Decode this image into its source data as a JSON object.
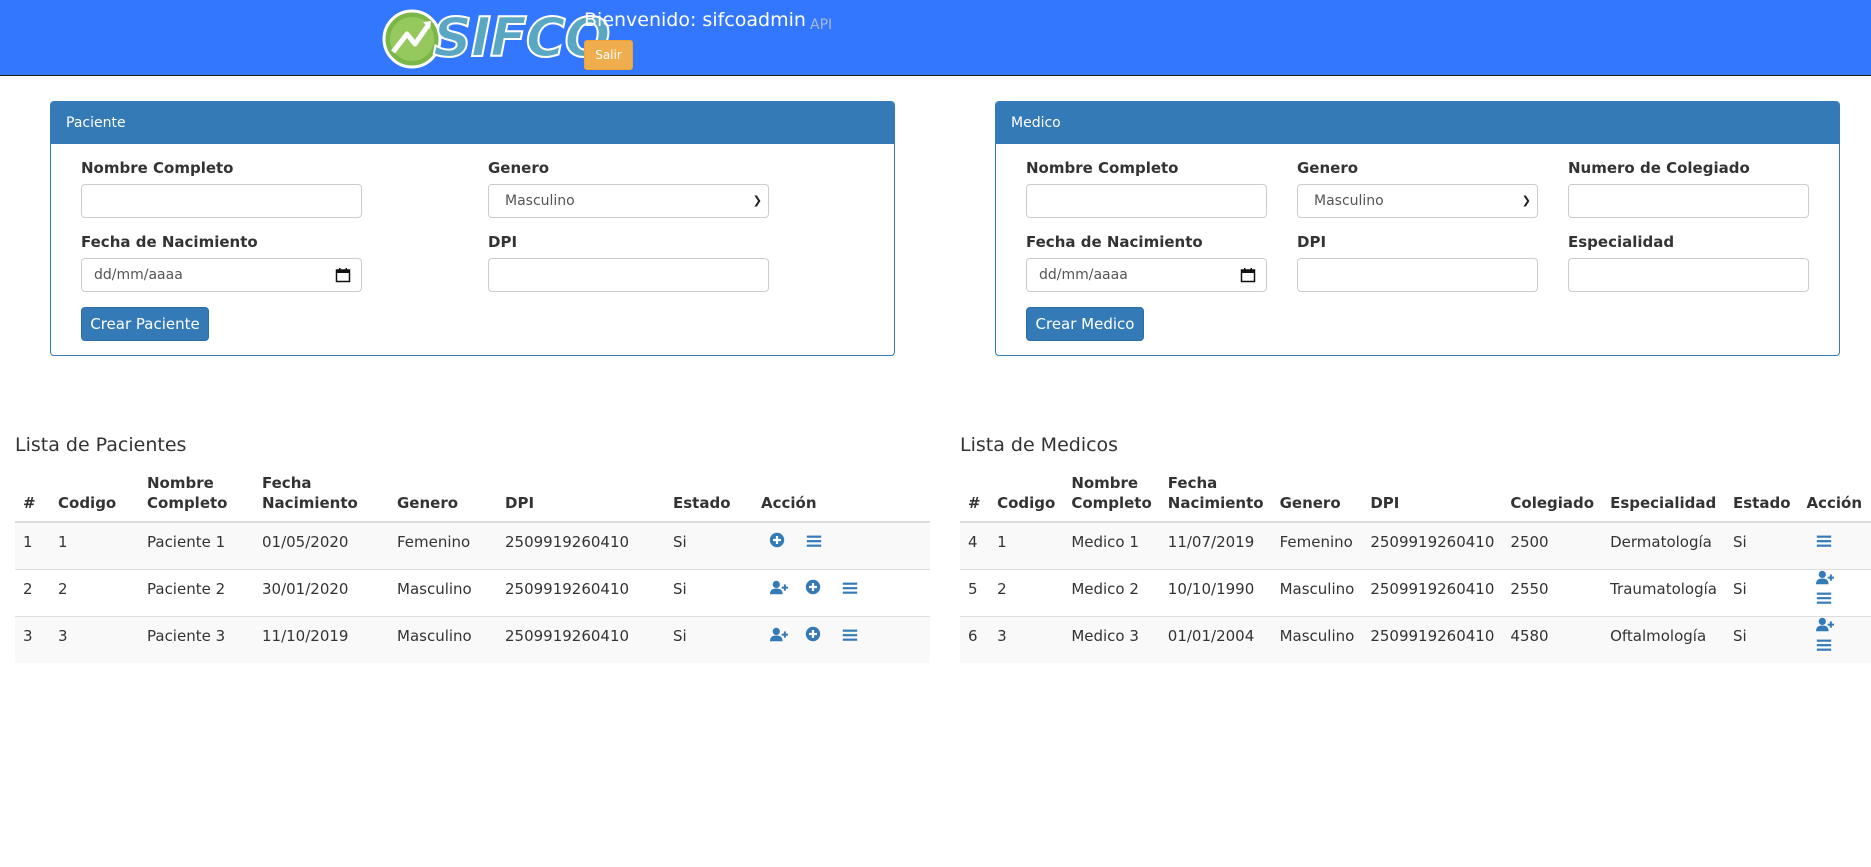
{
  "header": {
    "logo_text": "SIFCO",
    "welcome": "Bienvenido: sifcoadmin",
    "api_link": "API",
    "logout_label": "Salir",
    "bar_color": "#3377ff"
  },
  "paciente_form": {
    "title": "Paciente",
    "nombre_label": "Nombre Completo",
    "nombre_value": "",
    "genero_label": "Genero",
    "genero_selected": "Masculino",
    "fecha_label": "Fecha de Nacimiento",
    "fecha_placeholder": "dd/mm/aaaa",
    "dpi_label": "DPI",
    "dpi_value": "",
    "submit_label": "Crear Paciente"
  },
  "medico_form": {
    "title": "Medico",
    "nombre_label": "Nombre Completo",
    "genero_label": "Genero",
    "genero_selected": "Masculino",
    "colegiado_label": "Numero de Colegiado",
    "fecha_label": "Fecha de Nacimiento",
    "fecha_placeholder": "dd/mm/aaaa",
    "dpi_label": "DPI",
    "especialidad_label": "Especialidad",
    "submit_label": "Crear Medico"
  },
  "pacientes_list": {
    "title": "Lista de Pacientes",
    "headers": [
      "#",
      "Codigo",
      "Nombre Completo",
      "Fecha Nacimiento",
      "Genero",
      "DPI",
      "Estado",
      "Acción"
    ],
    "rows": [
      {
        "n": "1",
        "codigo": "1",
        "nombre": "Paciente 1",
        "fecha": "01/05/2020",
        "genero": "Femenino",
        "dpi": "2509919260410",
        "estado": "Si",
        "actions": [
          "plus-circle-icon",
          "list-icon"
        ]
      },
      {
        "n": "2",
        "codigo": "2",
        "nombre": "Paciente 2",
        "fecha": "30/01/2020",
        "genero": "Masculino",
        "dpi": "2509919260410",
        "estado": "Si",
        "actions": [
          "user-plus-icon",
          "plus-circle-icon",
          "list-icon"
        ]
      },
      {
        "n": "3",
        "codigo": "3",
        "nombre": "Paciente 3",
        "fecha": "11/10/2019",
        "genero": "Masculino",
        "dpi": "2509919260410",
        "estado": "Si",
        "actions": [
          "user-plus-icon",
          "plus-circle-icon",
          "list-icon"
        ]
      }
    ]
  },
  "medicos_list": {
    "title": "Lista de Medicos",
    "headers": [
      "#",
      "Codigo",
      "Nombre Completo",
      "Fecha Nacimiento",
      "Genero",
      "DPI",
      "Colegiado",
      "Especialidad",
      "Estado",
      "Acción"
    ],
    "rows": [
      {
        "n": "4",
        "codigo": "1",
        "nombre": "Medico 1",
        "fecha": "11/07/2019",
        "genero": "Femenino",
        "dpi": "2509919260410",
        "colegiado": "2500",
        "especialidad": "Dermatología",
        "estado": "Si",
        "actions": [
          "list-icon"
        ]
      },
      {
        "n": "5",
        "codigo": "2",
        "nombre": "Medico 2",
        "fecha": "10/10/1990",
        "genero": "Masculino",
        "dpi": "2509919260410",
        "colegiado": "2550",
        "especialidad": "Traumatología",
        "estado": "Si",
        "actions": [
          "user-plus-icon",
          "list-icon"
        ]
      },
      {
        "n": "6",
        "codigo": "3",
        "nombre": "Medico 3",
        "fecha": "01/01/2004",
        "genero": "Masculino",
        "dpi": "2509919260410",
        "colegiado": "4580",
        "especialidad": "Oftalmología",
        "estado": "Si",
        "actions": [
          "user-plus-icon",
          "list-icon"
        ]
      }
    ]
  },
  "colors": {
    "primary": "#337ab7",
    "warning": "#f0ad4e"
  }
}
